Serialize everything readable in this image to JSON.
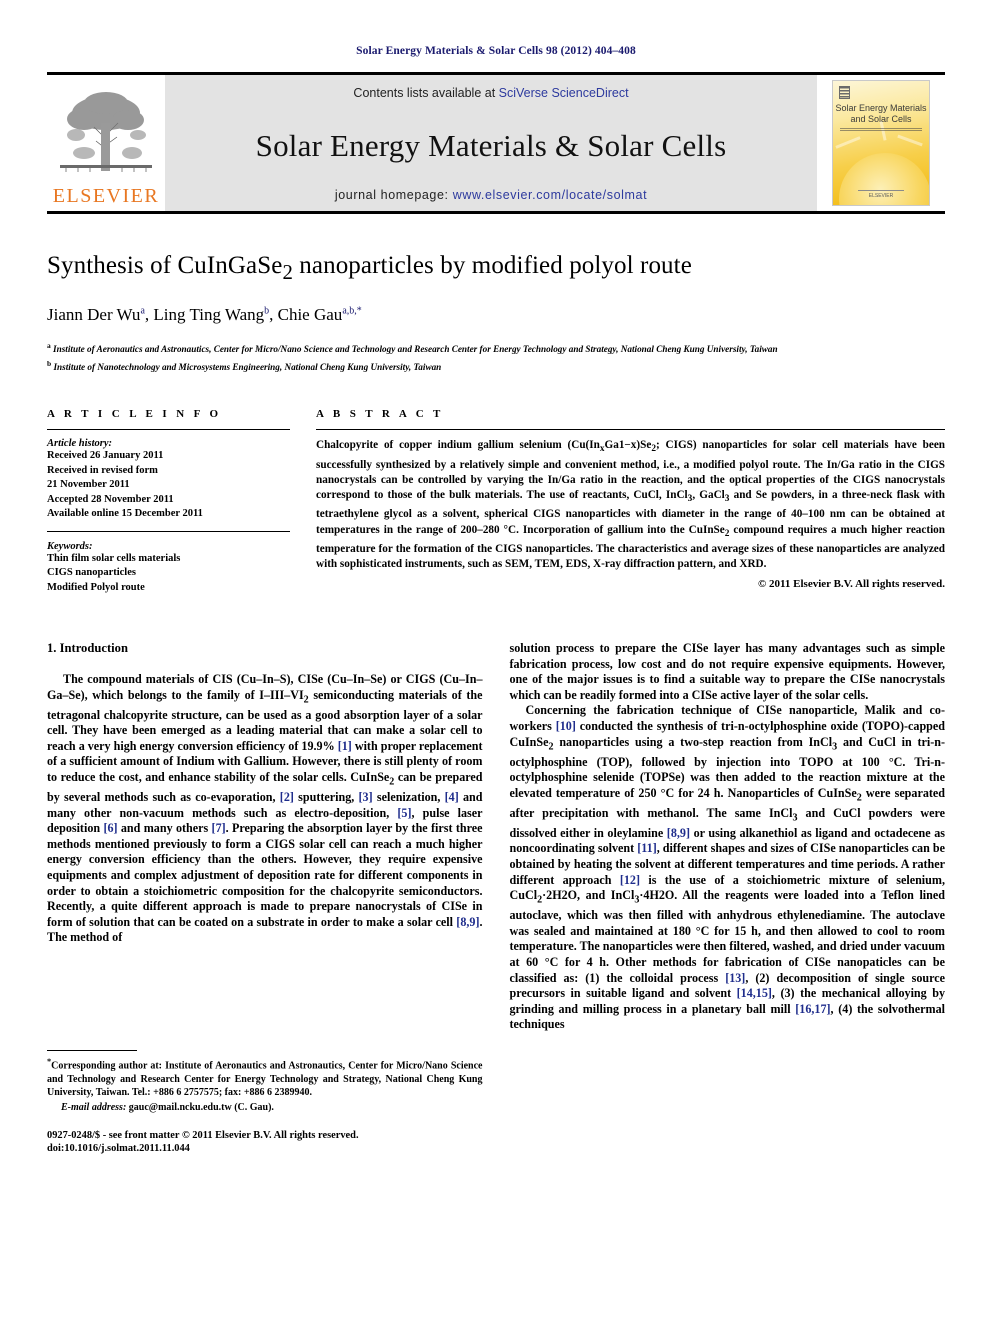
{
  "running_head": "Solar Energy Materials & Solar Cells 98 (2012) 404–408",
  "masthead": {
    "publisher_word": "ELSEVIER",
    "contents_prefix": "Contents lists available at ",
    "contents_link": "SciVerse ScienceDirect",
    "journal_name": "Solar Energy Materials & Solar Cells",
    "homepage_prefix": "journal homepage: ",
    "homepage_url": "www.elsevier.com/locate/solmat",
    "cover": {
      "title_line1": "Solar Energy Materials",
      "title_line2": "and Solar Cells",
      "footer": "ELSEVIER"
    }
  },
  "title_block": {
    "title_pre": "Synthesis of CuInGaSe",
    "title_sub": "2",
    "title_post": " nanoparticles by modified polyol route",
    "authors": [
      {
        "name": "Jiann Der Wu",
        "sup": "a",
        "sep": ", "
      },
      {
        "name": "Ling Ting Wang",
        "sup": "b",
        "sep": ", "
      },
      {
        "name": "Chie Gau",
        "sup": "a,b,",
        "sup_star": "*",
        "sep": ""
      }
    ],
    "affiliations": [
      {
        "marker": "a",
        "text": "Institute of Aeronautics and Astronautics, Center for Micro/Nano Science and Technology and Research Center for Energy Technology and Strategy, National Cheng Kung University, Taiwan"
      },
      {
        "marker": "b",
        "text": "Institute of Nanotechnology and Microsystems Engineering, National Cheng Kung University, Taiwan"
      }
    ]
  },
  "article_info": {
    "heading": "A R T I C L E  I N F O",
    "history_label": "Article history:",
    "history_lines": [
      "Received 26 January 2011",
      "Received in revised form",
      "21 November 2011",
      "Accepted 28 November 2011",
      "Available online 15 December 2011"
    ],
    "keywords_label": "Keywords:",
    "keywords": [
      "Thin film solar cells materials",
      "CIGS nanoparticles",
      "Modified Polyol route"
    ]
  },
  "abstract": {
    "heading": "A B S T R A C T",
    "text": "Chalcopyrite of copper indium gallium selenium (Cu(InxGa1−x)Se2; CIGS) nanoparticles for solar cell materials have been successfully synthesized by a relatively simple and convenient method, i.e., a modified polyol route. The In/Ga ratio in the CIGS nanocrystals can be controlled by varying the In/Ga ratio in the reaction, and the optical properties of the CIGS nanocrystals correspond to those of the bulk materials. The use of reactants, CuCl, InCl3, GaCl3 and Se powders, in a three-neck flask with tetraethylene glycol as a solvent, spherical CIGS nanoparticles with diameter in the range of 40–100 nm can be obtained at temperatures in the range of 200–280 °C. Incorporation of gallium into the CuInSe2 compound requires a much higher reaction temperature for the formation of the CIGS nanoparticles. The characteristics and average sizes of these nanoparticles are analyzed with sophisticated instruments, such as SEM, TEM, EDS, X-ray diffraction pattern, and XRD.",
    "copyright": "© 2011 Elsevier B.V. All rights reserved."
  },
  "body": {
    "section_title": "1.  Introduction",
    "left_paragraphs": [
      "The compound materials of CIS (Cu–In–S), CISe (Cu–In–Se) or CIGS (Cu–In–Ga–Se), which belongs to the family of I–III–VI2 semiconducting materials of the tetragonal chalcopyrite structure, can be used as a good absorption layer of a solar cell. They have been emerged as a leading material that can make a solar cell to reach a very high energy conversion efficiency of 19.9% [1] with proper replacement of a sufficient amount of Indium with Gallium. However, there is still plenty of room to reduce the cost, and enhance stability of the solar cells. CuInSe2 can be prepared by several methods such as co-evaporation, [2] sputtering, [3] selenization, [4] and many other non-vacuum methods such as electro-deposition, [5], pulse laser deposition [6] and many others [7]. Preparing the absorption layer by the first three methods mentioned previously to form a CIGS solar cell can reach a much higher energy conversion efficiency than the others. However, they require expensive equipments and complex adjustment of deposition rate for different components in order to obtain a stoichiometric composition for the chalcopyrite semiconductors. Recently, a quite different approach is made to prepare nanocrystals of CISe in form of solution that can be coated on a substrate in order to make a solar cell [8,9]. The method of"
    ],
    "right_paragraphs": [
      "solution process to prepare the CISe layer has many advantages such as simple fabrication process, low cost and do not require expensive equipments. However, one of the major issues is to find a suitable way to prepare the CISe nanocrystals which can be readily formed into a CISe active layer of the solar cells.",
      "Concerning the fabrication technique of CISe nanoparticle, Malik and co-workers [10] conducted the synthesis of tri-n-octylphosphine oxide (TOPO)-capped CuInSe2 nanoparticles using a two-step reaction from InCl3 and CuCl in tri-n-octylphosphine (TOP), followed by injection into TOPO at 100 °C. Tri-n-octylphosphine selenide (TOPSe) was then added to the reaction mixture at the elevated temperature of 250 °C for 24 h. Nanoparticles of CuInSe2 were separated after precipitation with methanol. The same InCl3 and CuCl powders were dissolved either in oleylamine [8,9] or using alkanethiol as ligand and octadecene as noncoordinating solvent [11], different shapes and sizes of CISe nanoparticles can be obtained by heating the solvent at different temperatures and time periods. A rather different approach [12] is the use of a stoichiometric mixture of selenium, CuCl2·2H2O, and InCl3·4H2O. All the reagents were loaded into a Teflon lined autoclave, which was then filled with anhydrous ethylenediamine. The autoclave was sealed and maintained at 180 °C for 15 h, and then allowed to cool to room temperature. The nanoparticles were then filtered, washed, and dried under vacuum at 60 °C for 4 h. Other methods for fabrication of CISe nanopaticles can be classified as: (1) the colloidal process [13], (2) decomposition of single source precursors in suitable ligand and solvent [14,15], (3) the mechanical alloying by grinding and milling process in a planetary ball mill [16,17], (4) the solvothermal techniques"
    ]
  },
  "footnote": {
    "corresponding": "Corresponding author at: Institute of Aeronautics and Astronautics, Center for Micro/Nano Science and Technology and Research Center for Energy Technology and Strategy, National Cheng Kung University, Taiwan. Tel.: +886 6 2757575; fax: +886 6 2389940.",
    "email_label": "E-mail address:",
    "email_value": " gauc@mail.ncku.edu.tw (C. Gau).",
    "issn_line": "0927-0248/$ - see front matter © 2011 Elsevier B.V. All rights reserved.",
    "doi_line": "doi:10.1016/j.solmat.2011.11.044"
  },
  "colors": {
    "link": "#2d3a9e",
    "reference": "#1f2d8c",
    "elsevier_orange": "#E87722",
    "masthead_bg": "#e3e3e3",
    "running_head": "#1a1a6e"
  }
}
